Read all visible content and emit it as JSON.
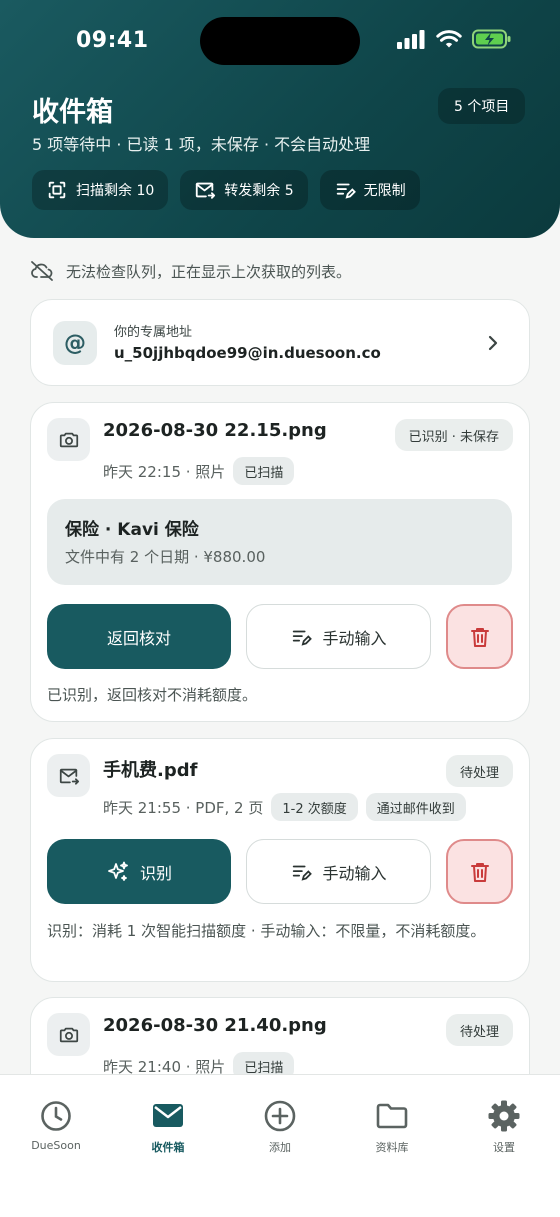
{
  "status_bar": {
    "time": "09:41"
  },
  "header": {
    "title": "收件箱",
    "count_badge": "5 个项目",
    "subtitle": "5 项等待中 · 已读 1 项，未保存 · 不会自动处理",
    "chips": [
      {
        "icon": "scan-icon",
        "label": "扫描剩余 10"
      },
      {
        "icon": "mail-forward-icon",
        "label": "转发剩余 5"
      },
      {
        "icon": "unlimited-edit-icon",
        "label": "无限制"
      }
    ]
  },
  "notice": {
    "icon": "cloud-off-icon",
    "text": "无法检查队列，正在显示上次获取的列表。"
  },
  "address": {
    "label": "你的专属地址",
    "value": "u_50jjhbqdoe99@in.duesoon.co"
  },
  "items": [
    {
      "icon": "camera-icon",
      "name": "2026-08-30 22.15.png",
      "status": "已识别 · 未保存",
      "meta": "昨天 22:15 · 照片",
      "tags": [
        "已扫描"
      ],
      "info": {
        "title": "保险 · Kavi 保险",
        "subtitle": "文件中有 2 个日期 · ¥880.00"
      },
      "primary_label": "返回核对",
      "secondary_label": "手动输入",
      "note": "已识别，返回核对不消耗额度。"
    },
    {
      "icon": "mail-forward-icon",
      "name": "手机费.pdf",
      "status": "待处理",
      "meta": "昨天 21:55 · PDF, 2 页",
      "tags": [
        "1-2 次额度",
        "通过邮件收到"
      ],
      "primary_label": "识别",
      "secondary_label": "手动输入",
      "note": "识别：消耗 1 次智能扫描额度 · 手动输入：不限量，不消耗额度。"
    },
    {
      "icon": "camera-icon",
      "name": "2026-08-30 21.40.png",
      "status": "待处理",
      "meta": "昨天 21:40 · 照片",
      "tags": [
        "已扫描"
      ]
    }
  ],
  "tabbar": [
    {
      "icon": "clock-icon",
      "label": "DueSoon",
      "active": false
    },
    {
      "icon": "envelope-icon",
      "label": "收件箱",
      "active": true
    },
    {
      "icon": "plus-circle-icon",
      "label": "添加",
      "active": false
    },
    {
      "icon": "folder-icon",
      "label": "资料库",
      "active": false
    },
    {
      "icon": "gear-icon",
      "label": "设置",
      "active": false
    }
  ],
  "colors": {
    "brand": "#185a60",
    "header_dark": "#0b3a3d",
    "delete_bg": "#fbe2e2",
    "delete_border": "#df8a8a",
    "delete_icon": "#c93b3b"
  }
}
